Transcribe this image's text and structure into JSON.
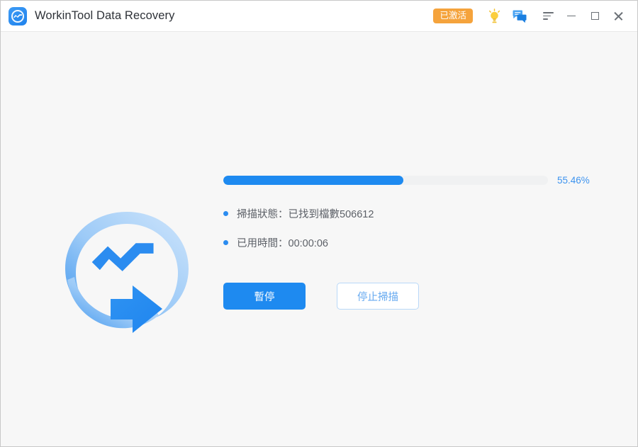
{
  "window": {
    "title": "WorkinTool Data Recovery",
    "app_icon": "workintool-logo-icon"
  },
  "titlebar": {
    "activated_badge": "已激活",
    "tip_icon": "lightbulb-icon",
    "feedback_icon": "chat-bubble-icon",
    "menu_icon": "menu-icon",
    "minimize_icon": "minimize-icon",
    "maximize_icon": "maximize-icon",
    "close_icon": "close-icon"
  },
  "main": {
    "illustration": "scanning-recovery-logo",
    "progress": {
      "percent_label": "55.46%",
      "percent_value": 55.46,
      "fill_color": "#1e8af0",
      "track_color": "#f0f1f2"
    },
    "status_lines": [
      {
        "text": "掃描狀態：已找到檔數506612"
      },
      {
        "text": "已用時間：00:00:06"
      }
    ],
    "buttons": {
      "pause": "暫停",
      "stop": "停止掃描"
    }
  },
  "colors": {
    "accent": "#1e8af0",
    "badge_orange": "#f5a33c",
    "outline_text": "#65a9f0"
  }
}
